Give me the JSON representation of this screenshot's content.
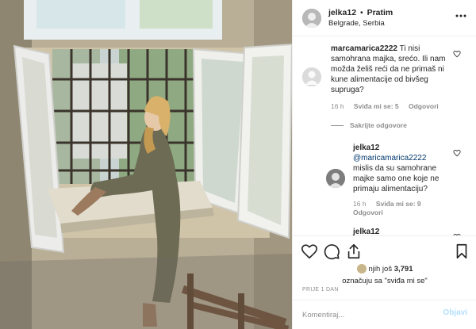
{
  "post": {
    "image_alt": "Woman in olive jumpsuit sitting on a window sill with barred window",
    "header": {
      "username": "jelka12",
      "separator": "•",
      "follow_status": "Pratim",
      "location": "Belgrade, Serbia",
      "more_icon": "more-horizontal-icon"
    },
    "comments": [
      {
        "username": "marcamarica2222",
        "text": "Ti nisi samohrana majka, srećo. Ili nam možda želiš reći da ne primaš ni kune alimentacije od bivšeg supruga?",
        "time": "16 h",
        "likes": "Sviđa mi se: 5",
        "reply_label": "Odgovori",
        "hide_replies": "Sakrijte odgovore",
        "replies": [
          {
            "username": "jelka12",
            "mention": "@maricamarica2222",
            "text": "mislis da su samohrane majke samo one koje ne primaju alimentaciju?",
            "time": "16 h",
            "likes": "Sviđa mi se: 9",
            "reply_label": "Odgovori"
          },
          {
            "username": "jelka12"
          }
        ]
      }
    ],
    "actions": {
      "like_icon": "heart-icon",
      "comment_icon": "comment-icon",
      "share_icon": "share-icon",
      "save_icon": "bookmark-icon"
    },
    "likes": {
      "line1_prefix": "njih još",
      "count": "3,791",
      "line2": "označuju sa \"sviđa mi se\""
    },
    "timestamp": "PRIJE 1 DAN",
    "add_comment": {
      "placeholder": "Komentiraj...",
      "post_label": "Objavi"
    }
  },
  "colors": {
    "link": "#00376b",
    "muted": "#8e8e8e",
    "post_button_disabled": "#b2dffc"
  }
}
